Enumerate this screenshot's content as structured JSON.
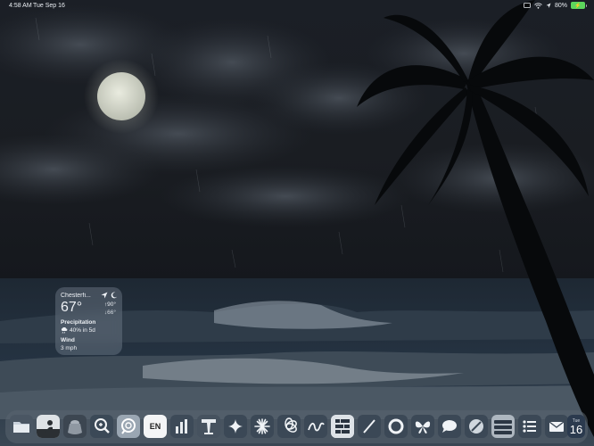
{
  "status_bar": {
    "time": "4:58 AM",
    "date": "Tue Sep 16",
    "battery_percent": "80%",
    "battery_level": 0.8,
    "icons": [
      "screen-mirror-icon",
      "wifi-icon",
      "location-arrow-icon",
      "battery-icon"
    ]
  },
  "weather_widget": {
    "city": "Chesterfi...",
    "temperature": "67°",
    "high": "↑90°",
    "low": "↓66°",
    "precipitation_label": "Precipitation",
    "precipitation_value": "40% in 5d",
    "wind_label": "Wind",
    "wind_value": "3 mph",
    "icons": [
      "location-arrow-icon",
      "moon-icon",
      "rain-cloud-icon"
    ]
  },
  "dock": {
    "apps": [
      {
        "name": "files",
        "icon": "folder-icon"
      },
      {
        "name": "kindle",
        "icon": "reader-icon"
      },
      {
        "name": "keychain",
        "icon": "keypad-icon"
      },
      {
        "name": "magnifier",
        "icon": "magnifier-icon"
      },
      {
        "name": "app-search",
        "icon": "search-app-icon"
      },
      {
        "name": "keyboard-language",
        "icon": "en-icon",
        "label": "EN"
      },
      {
        "name": "stats",
        "icon": "bar-chart-icon"
      },
      {
        "name": "keynote",
        "icon": "podium-icon"
      },
      {
        "name": "sparkle",
        "icon": "sparkle-icon"
      },
      {
        "name": "claude",
        "icon": "burst-icon"
      },
      {
        "name": "chatgpt",
        "icon": "knot-icon"
      },
      {
        "name": "freeform",
        "icon": "scribble-icon"
      },
      {
        "name": "shortcuts",
        "icon": "grid-list-icon"
      },
      {
        "name": "pencil",
        "icon": "pencil-icon"
      },
      {
        "name": "ring",
        "icon": "ring-icon"
      },
      {
        "name": "butterfly",
        "icon": "butterfly-icon"
      },
      {
        "name": "messages",
        "icon": "speech-bubble-icon"
      },
      {
        "name": "safari",
        "icon": "compass-icon"
      },
      {
        "name": "stacks",
        "icon": "stack-icon"
      },
      {
        "name": "reminders",
        "icon": "list-icon"
      },
      {
        "name": "mail",
        "icon": "envelope-icon"
      },
      {
        "name": "calendar",
        "icon": "calendar-icon",
        "day": "Tue",
        "date": "16"
      }
    ]
  }
}
